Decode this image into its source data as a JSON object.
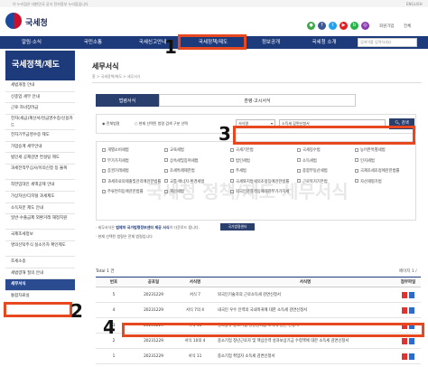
{
  "topbar": {
    "notice": "이 누리집은 대한민국 공식 전자정부 누리집입니다",
    "lang": "ENGLISH"
  },
  "header": {
    "logo_text": "국세청",
    "right_links": [
      "회원가입",
      "전체"
    ]
  },
  "sns": [
    {
      "name": "chat-icon",
      "glyph": "●",
      "color": "#3aa648"
    },
    {
      "name": "facebook-icon",
      "glyph": "f",
      "color": "#3b5998"
    },
    {
      "name": "twitter-icon",
      "glyph": "t",
      "color": "#1da1f2"
    },
    {
      "name": "youtube-icon",
      "glyph": "▶",
      "color": "#e02020"
    },
    {
      "name": "blog-icon",
      "glyph": "b",
      "color": "#27b34a"
    },
    {
      "name": "instagram-icon",
      "glyph": "◎",
      "color": "#8b3ab0"
    }
  ],
  "gnb": {
    "items": [
      "알림·소식",
      "국민소통",
      "국세신고안내",
      "국세정책/제도",
      "정보공개",
      "국세청 소개"
    ],
    "search_placeholder": "검색어를 입력하세요"
  },
  "sidebar": {
    "title": "국세정책/제도",
    "items": [
      "세법개정 안내",
      "신종업 세무 안내",
      "근로·자녀장려금",
      "전자(세금)계산서/현금영수증/신용카드",
      "전자기부금영수증 제도",
      "가업승계 세무안내",
      "법인세 공제감면 컨설팅 제도",
      "과세전적부심사/이의신청 등 불복",
      "착한임대인 세액공제 안내",
      "가상자산/디지털 과세제도",
      "소득처분 제도 안내",
      "일반·수출금제 외환거래 재정지원",
      "국제조세정보",
      "명의신탁주식 실소유자 확인제도",
      "조세소송",
      "세법령해 질의 안내",
      "세무서식",
      "통합자료실"
    ],
    "active_index": 16
  },
  "main": {
    "title": "세무서식",
    "breadcrumb": "홈 > 국세정책/제도 > 세무서식",
    "tabs": [
      "법령서식",
      "훈령·고시서식"
    ],
    "active_tab": 0
  },
  "search": {
    "radio_all": "전체법령",
    "radio_current": "현재 선택된 법령 검색 구분 선택",
    "select_value": "서식명",
    "input_value": "소득세 감면신청서",
    "button_label": "검색"
  },
  "categories": [
    "개별소비세법",
    "교육세법",
    "국세기본법",
    "국세징수법",
    "농어촌특별세법",
    "부가가치세법",
    "상속세및증여세법",
    "법인세법",
    "소득세법",
    "인지세법",
    "증권거래세법",
    "조세특례제한법",
    "주세법",
    "종합부동산세법",
    "국제조세조정에관한법률",
    "과세자료의제출및관리에관한법률",
    "교통·에너지·환경세법",
    "국세와지방세의조정등에관한법률",
    "근로복지기본법",
    "자산재평가법",
    "주류면허등에관한법률",
    "재산세법",
    "외국인관광객등에대한부가가치세"
  ],
  "notes": {
    "line1_prefix": "세무서식은 ",
    "line1_bold": "법제처 국가법령정보센터 제공 서식",
    "line1_suffix": "이 다운로드 됩니다.",
    "link_button": "국가법령센터",
    "line2": "현재 선택된 법령은 전체 법령입니다"
  },
  "watermark": "국세청 정책/제도 세무서식",
  "list": {
    "total": "Total 1 건",
    "page_info": "페이지 1 /",
    "headers": [
      "번호",
      "공포일",
      "서식명",
      "서식명",
      "첨부파일"
    ],
    "rows": [
      {
        "no": "5",
        "date": "20231229",
        "form_no": "서식 7",
        "title": "외국인기술자의 근로소득세 감면신청서"
      },
      {
        "no": "4",
        "date": "20231229",
        "form_no": "서식 7의 4",
        "title": "내국인 우수 인력의 국내복귀에 대한 소득세 감면신청서"
      },
      {
        "no": "3",
        "date": "20231229",
        "form_no": "서식 10",
        "title": "성과공유 중소기업 경영성과급 소득세 감면 신청서"
      },
      {
        "no": "2",
        "date": "20231229",
        "form_no": "서식 10의 4",
        "title": "중소기업 청년근로자 및 핵심인력 성과보상기금 수령액에 대한 소득세 감면신청서"
      },
      {
        "no": "1",
        "date": "20231229",
        "form_no": "서식 11",
        "title": "중소기업 취업자 소득세 감면신청서"
      }
    ]
  },
  "markers": [
    "1",
    "2",
    "3",
    "4"
  ],
  "colors": {
    "navy": "#1d3a7a",
    "highlight": "#e8481f"
  }
}
